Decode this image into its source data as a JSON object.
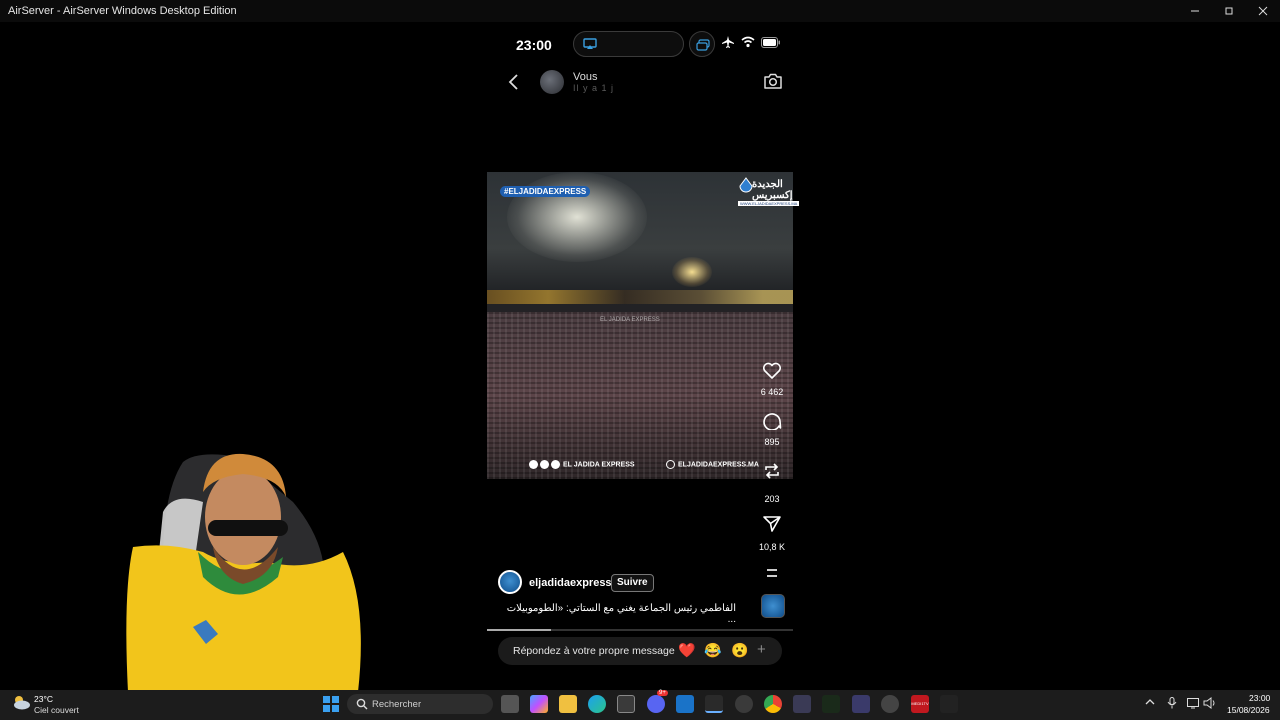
{
  "window": {
    "title": "AirServer - AirServer Windows Desktop Edition"
  },
  "phone_status": {
    "time": "23:00"
  },
  "header": {
    "name": "Vous",
    "subtitle": "Il y a 1 j"
  },
  "video": {
    "tag": "#ELJADIDAEXPRESS",
    "logo_text": "الجديدة إكسبريس",
    "logo_url": "WWW.ELJADIDAEXPRESS.MA",
    "watermark_left": "EL JADIDA EXPRESS",
    "watermark_right": "ELJADIDAEXPRESS.MA",
    "watermark_mid": "EL JADIDA EXPRESS"
  },
  "actions": {
    "likes": "6 462",
    "comments": "895",
    "reposts": "203",
    "shares": "10,8 K"
  },
  "post": {
    "account": "eljadidaexpress",
    "follow_label": "Suivre",
    "caption": "الفاطمي رئيس الجماعة يغني مع الستاتي: «الطوموبيلات ...",
    "progress": 0.21
  },
  "reply": {
    "placeholder": "Répondez à votre propre message",
    "emojis": [
      "❤️",
      "😂",
      "😮"
    ],
    "plus": "+"
  },
  "taskbar": {
    "weather_temp": "23°C",
    "weather_desc": "Ciel couvert",
    "search_placeholder": "Rechercher",
    "clock_time": "23:00",
    "clock_date": "15/08/2026",
    "notification_badge": "9+",
    "news_app_label": "MEDI1TV"
  }
}
